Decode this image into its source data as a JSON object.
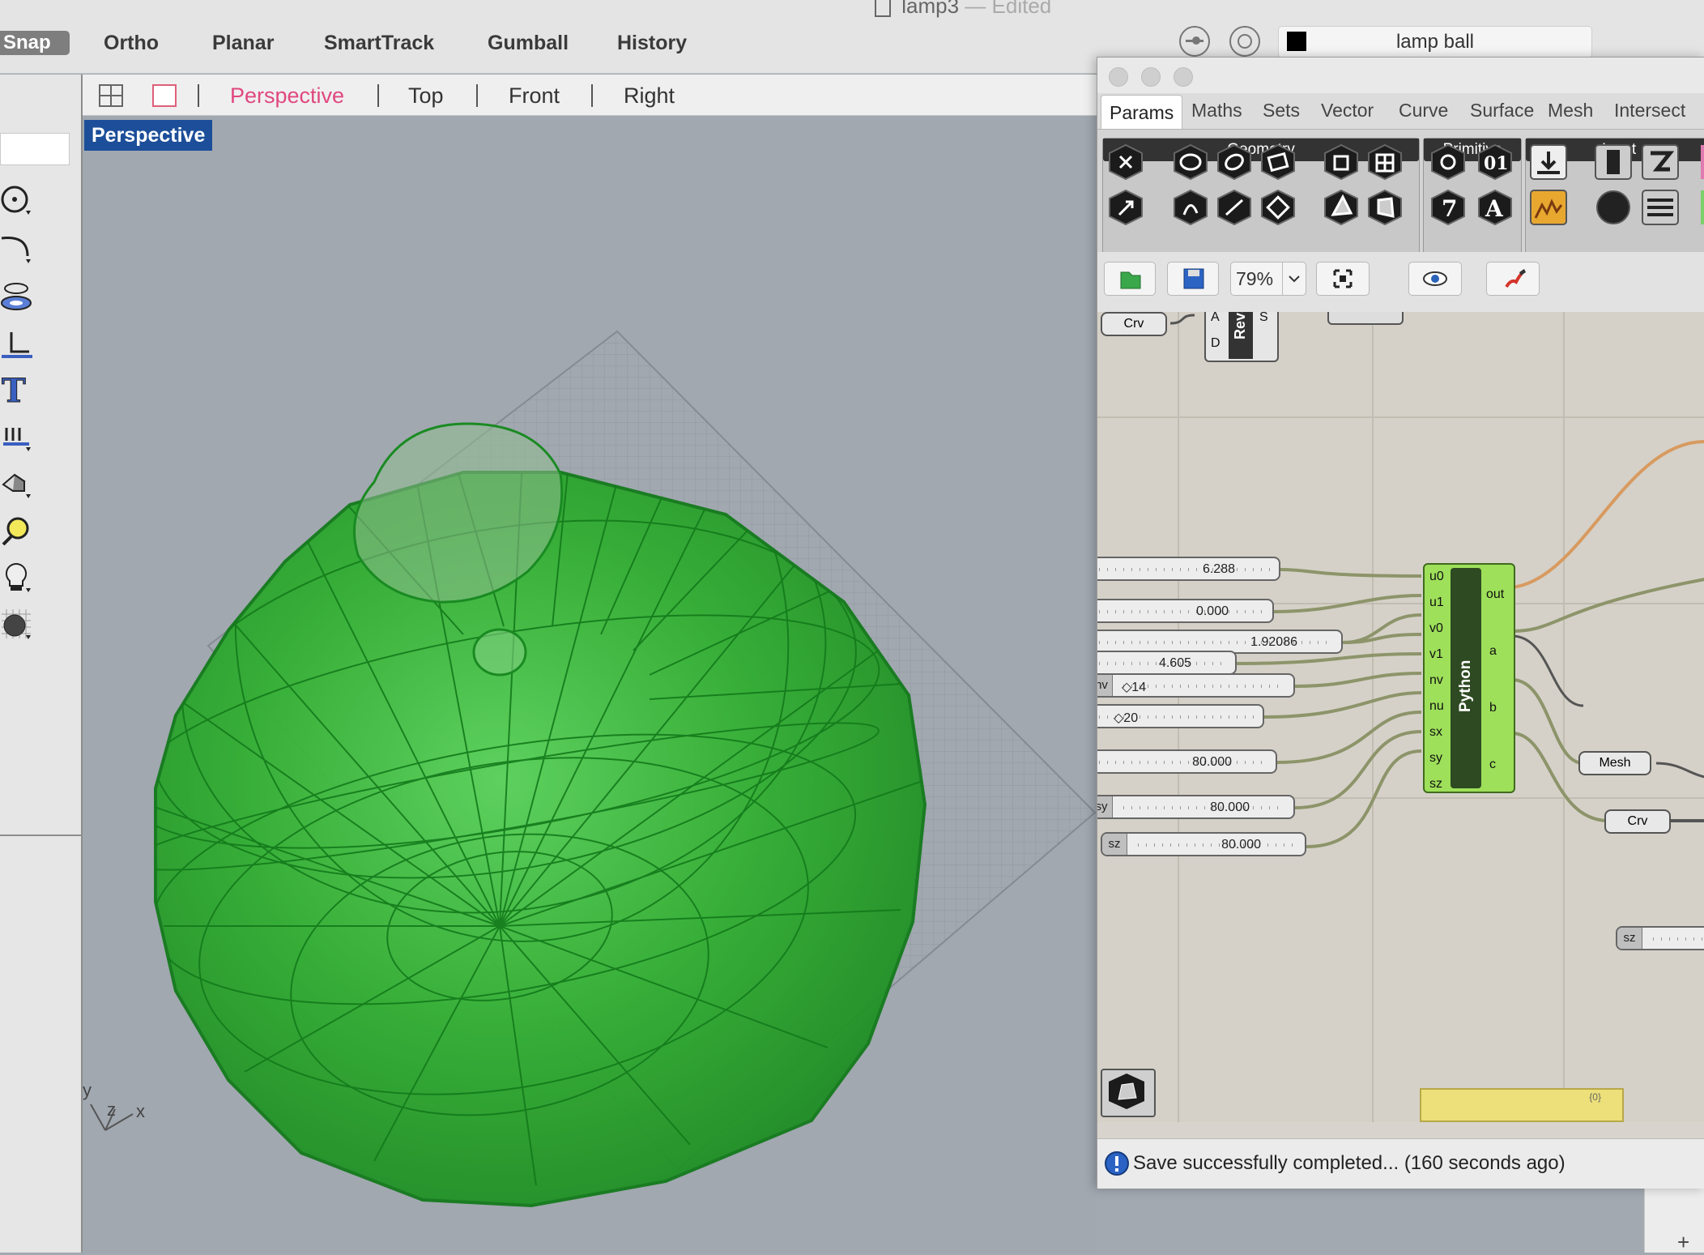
{
  "window": {
    "title": "lamp3",
    "title_suffix": "— Edited"
  },
  "toolbar": {
    "snap": "Snap",
    "modes": [
      "Ortho",
      "Planar",
      "SmartTrack",
      "Gumball",
      "History"
    ],
    "layer_name": "lamp ball",
    "layer_color": "#000000"
  },
  "viewport_tabs": [
    "Perspective",
    "Top",
    "Front",
    "Right"
  ],
  "active_viewport": "Perspective",
  "viewport_label": "Perspective",
  "axes": {
    "x": "x",
    "y": "y",
    "z": "z"
  },
  "grasshopper": {
    "tabs": [
      "Params",
      "Maths",
      "Sets",
      "Vector",
      "Curve",
      "Surface",
      "Mesh",
      "Intersect"
    ],
    "active_tab": "Params",
    "ribbon_groups": [
      "Geometry",
      "Primitive",
      "Input"
    ],
    "zoom": "79%",
    "status": "Save successfully completed... (160 seconds ago)",
    "components": {
      "crv_top": "Crv",
      "revs": "RevS",
      "revs_inputs": [
        "A",
        "D"
      ],
      "revs_output": "S",
      "python": "Python",
      "python_inputs": [
        "u0",
        "u1",
        "v0",
        "v1",
        "nv",
        "nu",
        "sx",
        "sy",
        "sz"
      ],
      "python_outputs": [
        "out",
        "a",
        "b",
        "c"
      ],
      "mesh": "Mesh",
      "crv": "Crv",
      "panel_count": "{0}"
    },
    "sliders": [
      {
        "label": "",
        "value": "6.288"
      },
      {
        "label": "",
        "value": "0.000"
      },
      {
        "label": "",
        "value": "1.92086"
      },
      {
        "label": "",
        "value": "4.605"
      },
      {
        "label": "nv",
        "value": "◇14"
      },
      {
        "label": "",
        "value": "◇20"
      },
      {
        "label": "",
        "value": "80.000"
      },
      {
        "label": "sy",
        "value": "80.000"
      },
      {
        "label": "sz",
        "value": "80.000"
      },
      {
        "label": "sz",
        "value": ""
      }
    ]
  },
  "colors": {
    "accent_pink": "#e0487f",
    "mesh_green": "#2fb52f",
    "python_green": "#9ee05a",
    "viewport_label_bg": "#1c4e99"
  }
}
